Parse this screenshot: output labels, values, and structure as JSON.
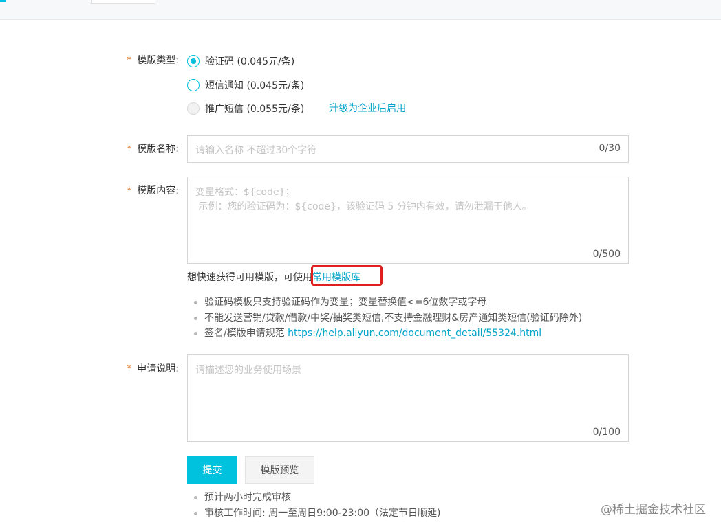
{
  "form": {
    "template_type": {
      "label": "模版类型:",
      "options": [
        {
          "label": "验证码 (0.045元/条)",
          "state": "checked"
        },
        {
          "label": "短信通知 (0.045元/条)",
          "state": "unchecked"
        },
        {
          "label": "推广短信 (0.055元/条)",
          "state": "disabled"
        }
      ],
      "upgrade_link": "升级为企业后启用"
    },
    "template_name": {
      "label": "模版名称:",
      "placeholder": "请输入名称 不超过30个字符",
      "counter": "0/30"
    },
    "template_content": {
      "label": "模版内容:",
      "placeholder_line1": "变量格式：${code}；",
      "placeholder_line2": " 示例：您的验证码为：${code}，该验证码 5 分钟内有效，请勿泄漏于他人。",
      "counter": "0/500"
    },
    "library_hint": {
      "text": "想快速获得可用模版，可使用",
      "link": "常用模版库"
    },
    "notes": {
      "items": [
        "验证码模板只支持验证码作为变量；变量替换值<=6位数字或字母",
        "不能发送营销/贷款/借款/中奖/抽奖类短信,不支持金融理财&房产通知类短信(验证码除外)"
      ],
      "spec_text": "签名/模版申请规范 ",
      "spec_link": "https://help.aliyun.com/document_detail/55324.html"
    },
    "application_note": {
      "label": "申请说明:",
      "placeholder": "请描述您的业务使用场景",
      "counter": "0/100"
    },
    "buttons": {
      "submit": "提交",
      "preview": "模版预览"
    },
    "footer_notes": [
      "预计两小时完成审核",
      "审核工作时间: 周一至周日9:00-23:00（法定节日顺延)"
    ]
  },
  "watermark": "@稀土掘金技术社区",
  "colors": {
    "accent": "#00c1de",
    "link": "#00a3c9",
    "required_star": "#e07a2a",
    "highlight_box": "#e02020"
  }
}
